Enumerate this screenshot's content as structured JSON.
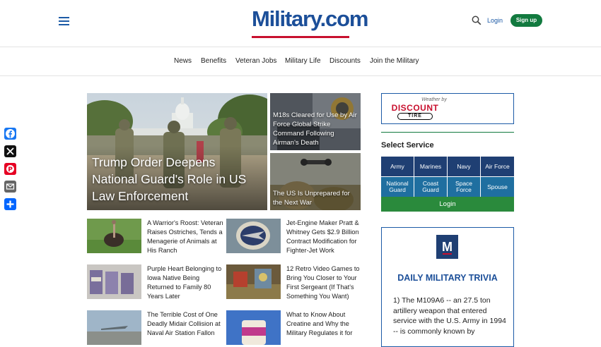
{
  "header": {
    "logo_text": "Military.com",
    "login_label": "Login",
    "signup_label": "Sign up"
  },
  "nav": {
    "items": [
      "News",
      "Benefits",
      "Veteran Jobs",
      "Military Life",
      "Discounts",
      "Join the Military"
    ]
  },
  "share": {
    "icons": [
      "facebook-icon",
      "x-icon",
      "pinterest-icon",
      "email-icon",
      "share-plus-icon"
    ]
  },
  "hero": {
    "headline": "Trump Order Deepens National Guard's Role in US Law Enforcement"
  },
  "tiles": {
    "top_right": "M18s Cleared for Use by Air Force Global Strike Command Following Airman's Death",
    "bottom_right": "The US Is Unprepared for the Next War"
  },
  "stories": [
    {
      "title": "A Warrior's Roost: Veteran Raises Ostriches, Tends a Menagerie of Animals at His Ranch"
    },
    {
      "title": "Jet-Engine Maker Pratt & Whitney Gets $2.9 Billion Contract Modification for Fighter-Jet Work"
    },
    {
      "title": "Purple Heart Belonging to Iowa Native Being Returned to Family 80 Years Later"
    },
    {
      "title": "12 Retro Video Games to Bring You Closer to Your First Sergeant (If That's Something You Want)"
    },
    {
      "title": "The Terrible Cost of One Deadly Midair Collision at Naval Air Station Fallon"
    },
    {
      "title": "What to Know About Creatine and Why the Military Regulates it for"
    }
  ],
  "weather": {
    "sponsor_prefix": "Weather by",
    "brand_top": "DISCOUNT",
    "brand_bottom": "TIRE"
  },
  "services": {
    "title": "Select Service",
    "row1": [
      "Army",
      "Marines",
      "Navy",
      "Air Force"
    ],
    "row2": [
      "National Guard",
      "Coast Guard",
      "Space Force",
      "Spouse"
    ],
    "login_label": "Login"
  },
  "trivia": {
    "badge": "M",
    "title": "DAILY MILITARY TRIVIA",
    "question": "1) The M109A6 -- an 27.5 ton artillery weapon that entered service with the U.S. Army in 1994 -- is commonly known by"
  },
  "colors": {
    "brand_blue": "#1c4f99",
    "brand_red": "#c8102e",
    "green": "#127a3f",
    "service_dark": "#1f3f73",
    "service_light": "#1f6fa0"
  }
}
